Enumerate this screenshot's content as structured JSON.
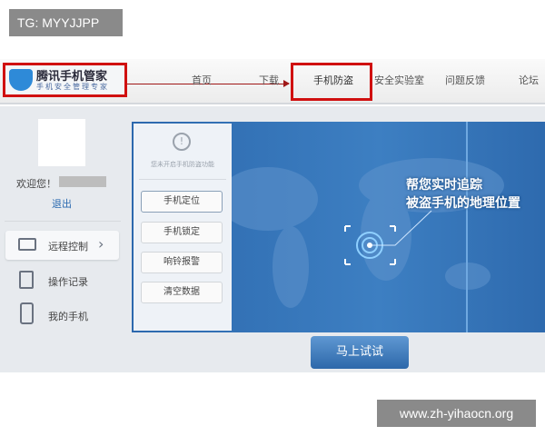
{
  "watermark_top": "TG: MYYJJPP",
  "watermark_bottom": "www.zh-yihaocn.org",
  "logo": {
    "title": "腾讯手机管家",
    "slogan": "手机安全管理专家"
  },
  "nav": [
    "首页",
    "下载",
    "手机防盗",
    "安全实验室",
    "问题反馈",
    "论坛"
  ],
  "sidebar": {
    "welcome": "欢迎您！",
    "logout": "退出",
    "items": [
      {
        "label": "远程控制",
        "icon": "monitor-icon"
      },
      {
        "label": "操作记录",
        "icon": "list-icon"
      },
      {
        "label": "我的手机",
        "icon": "phone-icon"
      }
    ]
  },
  "panel": {
    "notice": "您未开启手机防盗功能",
    "buttons": [
      "手机定位",
      "手机锁定",
      "响铃报警",
      "清空数据"
    ]
  },
  "banner": {
    "line1": "帮您实时追踪",
    "line2": "被盗手机的地理位置"
  },
  "try_button": "马上试试",
  "colors": {
    "highlight": "#d01010",
    "brand_blue": "#2c68ad"
  }
}
